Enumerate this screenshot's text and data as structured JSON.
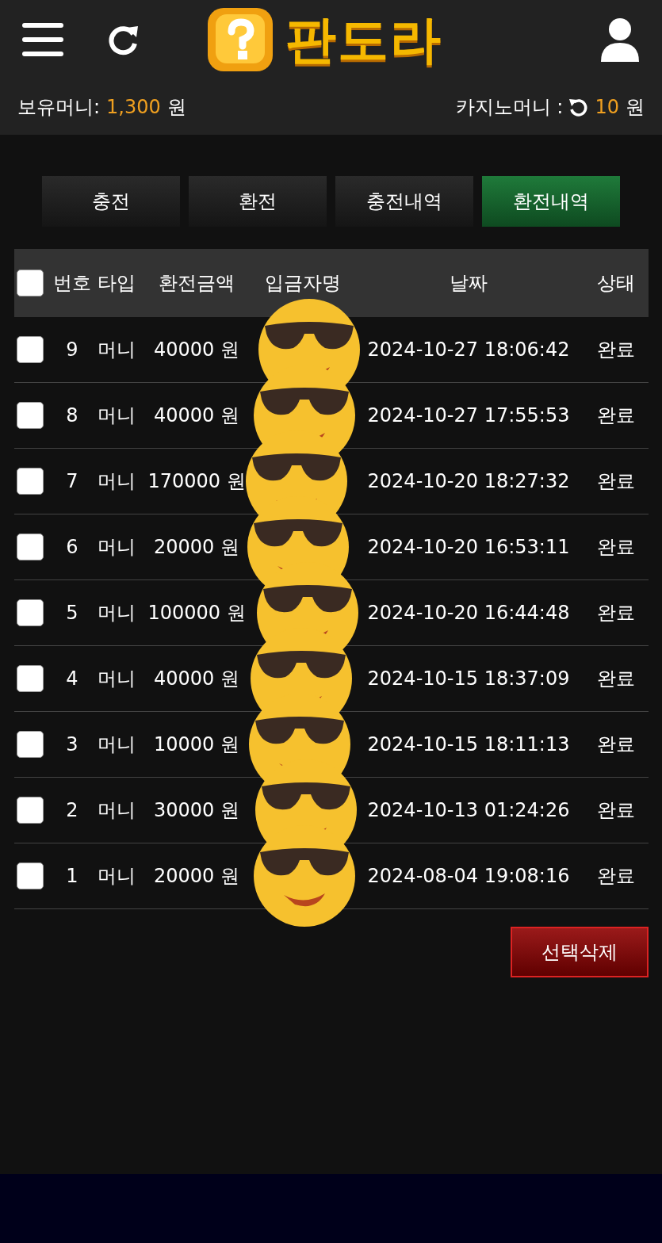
{
  "header": {
    "logo_text": "판도라",
    "balance_label": "보유머니:",
    "balance_value": "1,300",
    "balance_unit": "원",
    "casino_label": "카지노머니 :",
    "casino_value": "10",
    "casino_unit": "원"
  },
  "tabs": [
    {
      "label": "충전",
      "selected": false
    },
    {
      "label": "환전",
      "selected": false
    },
    {
      "label": "충전내역",
      "selected": false
    },
    {
      "label": "환전내역",
      "selected": true
    }
  ],
  "table": {
    "select_all_checked": false,
    "columns": [
      "번호",
      "타입",
      "환전금액",
      "입금자명",
      "날짜",
      "상태"
    ],
    "rows": [
      {
        "checked": false,
        "number": "9",
        "type": "머니",
        "amount": "40000 원",
        "date": "2024-10-27 18:06:42",
        "status": "완료"
      },
      {
        "checked": false,
        "number": "8",
        "type": "머니",
        "amount": "40000 원",
        "date": "2024-10-27 17:55:53",
        "status": "완료"
      },
      {
        "checked": false,
        "number": "7",
        "type": "머니",
        "amount": "170000 원",
        "date": "2024-10-20 18:27:32",
        "status": "완료"
      },
      {
        "checked": false,
        "number": "6",
        "type": "머니",
        "amount": "20000 원",
        "date": "2024-10-20 16:53:11",
        "status": "완료"
      },
      {
        "checked": false,
        "number": "5",
        "type": "머니",
        "amount": "100000 원",
        "date": "2024-10-20 16:44:48",
        "status": "완료"
      },
      {
        "checked": false,
        "number": "4",
        "type": "머니",
        "amount": "40000 원",
        "date": "2024-10-15 18:37:09",
        "status": "완료"
      },
      {
        "checked": false,
        "number": "3",
        "type": "머니",
        "amount": "10000 원",
        "date": "2024-10-15 18:11:13",
        "status": "완료"
      },
      {
        "checked": false,
        "number": "2",
        "type": "머니",
        "amount": "30000 원",
        "date": "2024-10-13 01:24:26",
        "status": "완료"
      },
      {
        "checked": false,
        "number": "1",
        "type": "머니",
        "amount": "20000 원",
        "date": "2024-08-04 19:08:16",
        "status": "완료"
      }
    ]
  },
  "delete_button": "선택삭제"
}
